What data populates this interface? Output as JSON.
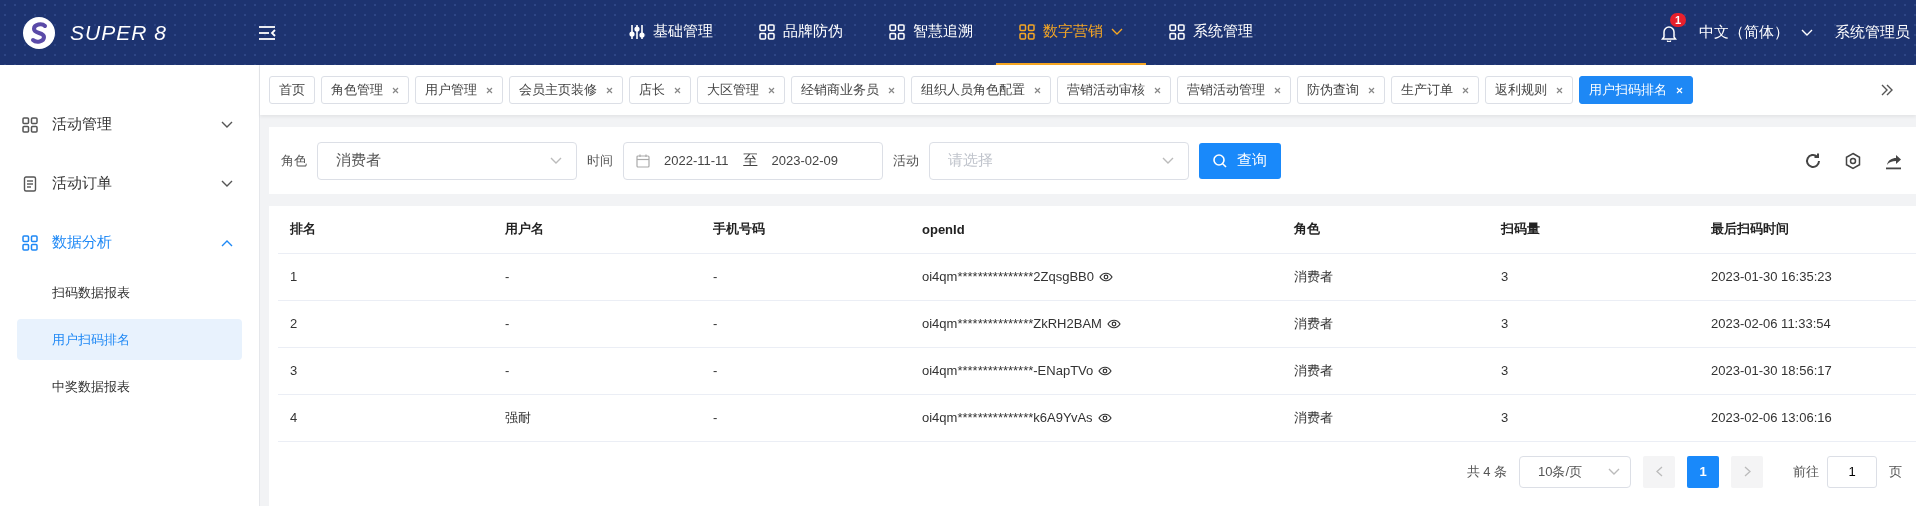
{
  "header": {
    "logo_text": "SUPER 8",
    "nav": [
      {
        "label": "基础管理",
        "selected": false,
        "dropdown": false
      },
      {
        "label": "品牌防伪",
        "selected": false,
        "dropdown": false
      },
      {
        "label": "智慧追溯",
        "selected": false,
        "dropdown": false
      },
      {
        "label": "数字营销",
        "selected": true,
        "dropdown": true
      },
      {
        "label": "系统管理",
        "selected": false,
        "dropdown": false
      }
    ],
    "notification_count": "1",
    "language": "中文（简体）",
    "user": "系统管理员"
  },
  "sidebar": {
    "items": [
      {
        "label": "活动管理",
        "expanded": false
      },
      {
        "label": "活动订单",
        "expanded": false
      },
      {
        "label": "数据分析",
        "expanded": true,
        "children": [
          {
            "label": "扫码数据报表",
            "selected": false
          },
          {
            "label": "用户扫码排名",
            "selected": true
          },
          {
            "label": "中奖数据报表",
            "selected": false
          }
        ]
      }
    ]
  },
  "tabs": [
    {
      "label": "首页",
      "closable": false,
      "selected": false
    },
    {
      "label": "角色管理",
      "closable": true,
      "selected": false
    },
    {
      "label": "用户管理",
      "closable": true,
      "selected": false
    },
    {
      "label": "会员主页装修",
      "closable": true,
      "selected": false
    },
    {
      "label": "店长",
      "closable": true,
      "selected": false
    },
    {
      "label": "大区管理",
      "closable": true,
      "selected": false
    },
    {
      "label": "经销商业务员",
      "closable": true,
      "selected": false
    },
    {
      "label": "组织人员角色配置",
      "closable": true,
      "selected": false
    },
    {
      "label": "营销活动审核",
      "closable": true,
      "selected": false
    },
    {
      "label": "营销活动管理",
      "closable": true,
      "selected": false
    },
    {
      "label": "防伪查询",
      "closable": true,
      "selected": false
    },
    {
      "label": "生产订单",
      "closable": true,
      "selected": false
    },
    {
      "label": "返利规则",
      "closable": true,
      "selected": false
    },
    {
      "label": "用户扫码排名",
      "closable": true,
      "selected": true
    }
  ],
  "filters": {
    "role_label": "角色",
    "role_value": "消费者",
    "time_label": "时间",
    "date_start": "2022-11-11",
    "date_sep": "至",
    "date_end": "2023-02-09",
    "activity_label": "活动",
    "activity_placeholder": "请选择",
    "search_button": "查询"
  },
  "table": {
    "columns": [
      "排名",
      "用户名",
      "手机号码",
      "openId",
      "角色",
      "扫码量",
      "最后扫码时间"
    ],
    "rows": [
      [
        "1",
        "-",
        "-",
        "oi4qm***************2ZqsgBB0",
        "消费者",
        "3",
        "2023-01-30 16:35:23"
      ],
      [
        "2",
        "-",
        "-",
        "oi4qm***************ZkRH2BAM",
        "消费者",
        "3",
        "2023-02-06 11:33:54"
      ],
      [
        "3",
        "-",
        "-",
        "oi4qm***************-ENapTVo",
        "消费者",
        "3",
        "2023-01-30 18:56:17"
      ],
      [
        "4",
        "强耐",
        "-",
        "oi4qm***************k6A9YvAs",
        "消费者",
        "3",
        "2023-02-06 13:06:16"
      ]
    ]
  },
  "pagination": {
    "total": "共 4 条",
    "page_size": "10条/页",
    "pages": [
      {
        "label": "1",
        "selected": true
      }
    ],
    "goto_label": "前往",
    "goto_value": "1",
    "page_suffix": "页"
  }
}
